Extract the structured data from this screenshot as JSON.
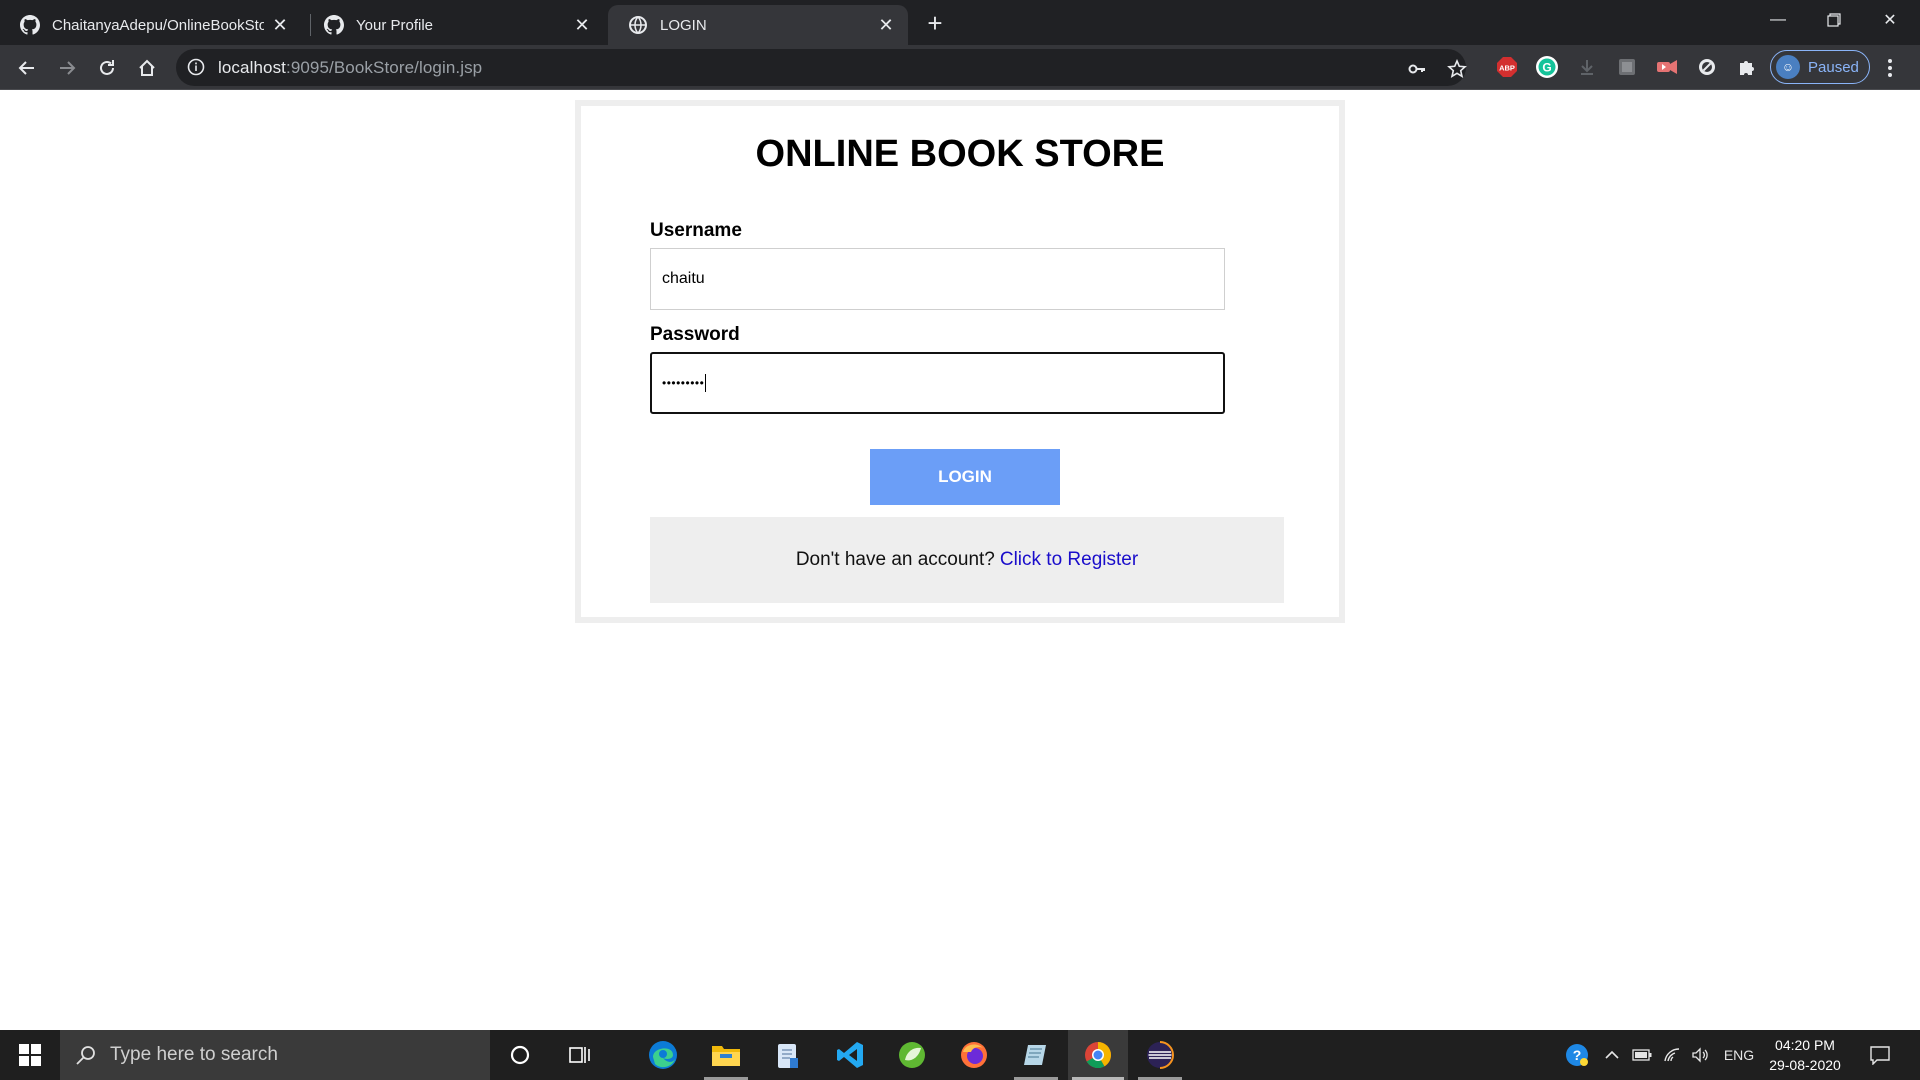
{
  "browser": {
    "tabs": [
      {
        "title": "ChaitanyaAdepu/OnlineBookStor",
        "icon": "github-icon",
        "active": false
      },
      {
        "title": "Your Profile",
        "icon": "github-icon",
        "active": false
      },
      {
        "title": "LOGIN",
        "icon": "globe-icon",
        "active": true
      }
    ],
    "url_host": "localhost",
    "url_rest": ":9095/BookStore/login.jsp",
    "profile_status": "Paused",
    "extensions": [
      "password-key-icon",
      "bookmark-star-icon",
      "adblock-plus-icon",
      "grammarly-icon",
      "download-icon",
      "extension-square-icon",
      "video-extension-icon",
      "block-icon",
      "puzzle-icon"
    ]
  },
  "page": {
    "heading": "ONLINE BOOK STORE",
    "username_label": "Username",
    "username_value": "chaitu",
    "password_label": "Password",
    "password_mask": "•••••••••",
    "login_label": "LOGIN",
    "register_prompt": "Don't have an account?",
    "register_link": "Click to Register"
  },
  "taskbar": {
    "search_placeholder": "Type here to search",
    "apps": [
      "cortana-icon",
      "task-view-icon",
      "edge-icon",
      "file-explorer-icon",
      "notepad-icon",
      "vscode-icon",
      "spring-icon",
      "firefox-icon",
      "notepad-plus-icon",
      "chrome-icon",
      "eclipse-icon"
    ],
    "language": "ENG",
    "time": "04:20 PM",
    "date": "29-08-2020"
  },
  "colors": {
    "accent_button": "#6b9ef7",
    "link": "#1a0dcb",
    "chrome_dark": "#202124",
    "chrome_toolbar": "#35363a"
  }
}
